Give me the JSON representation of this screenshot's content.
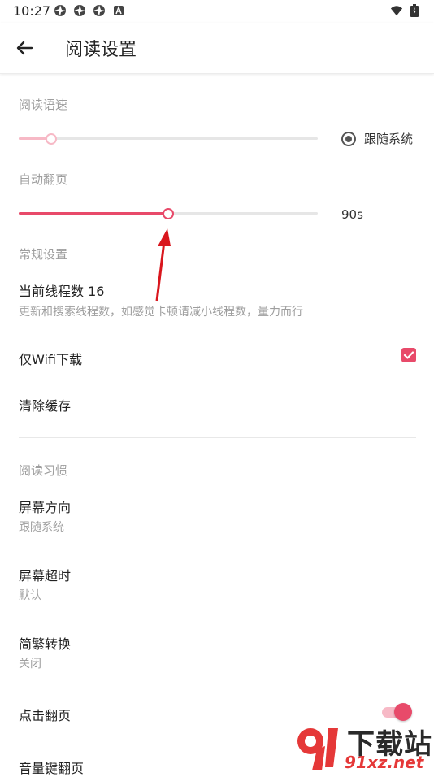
{
  "status_bar": {
    "time": "10:27",
    "left_icons": [
      "aperture-icon",
      "aperture-icon",
      "aperture-icon",
      "a-badge-icon"
    ],
    "right_icons": [
      "wifi-icon",
      "battery-icon"
    ]
  },
  "app_bar": {
    "title": "阅读设置",
    "back_icon": "arrow-left-icon"
  },
  "reading_speed": {
    "header": "阅读语速",
    "slider_value": 0.11,
    "follow_system_label": "跟随系统",
    "follow_system_selected": true
  },
  "auto_page": {
    "header": "自动翻页",
    "slider_value": 0.5,
    "value_label": "90s"
  },
  "general": {
    "header": "常规设置",
    "threads_title": "当前线程数 16",
    "threads_desc": "更新和搜索线程数，如感觉卡顿请减小线程数，量力而行",
    "wifi_only_label": "仅Wifi下载",
    "wifi_only_checked": true,
    "clear_cache_label": "清除缓存"
  },
  "habits": {
    "header": "阅读习惯",
    "orientation_title": "屏幕方向",
    "orientation_value": "跟随系统",
    "timeout_title": "屏幕超时",
    "timeout_value": "默认",
    "convert_title": "简繁转换",
    "convert_value": "关闭",
    "tap_page_title": "点击翻页",
    "tap_page_enabled": true,
    "volume_key_title": "音量键翻页"
  },
  "watermark": {
    "top_text": "下载站",
    "bottom_text": "91xz.net"
  },
  "colors": {
    "accent": "#e84a6a",
    "accent_light": "#f7b9c6",
    "arrow": "#d9161d",
    "text_primary": "#222222",
    "text_secondary": "#9e9e9e"
  }
}
